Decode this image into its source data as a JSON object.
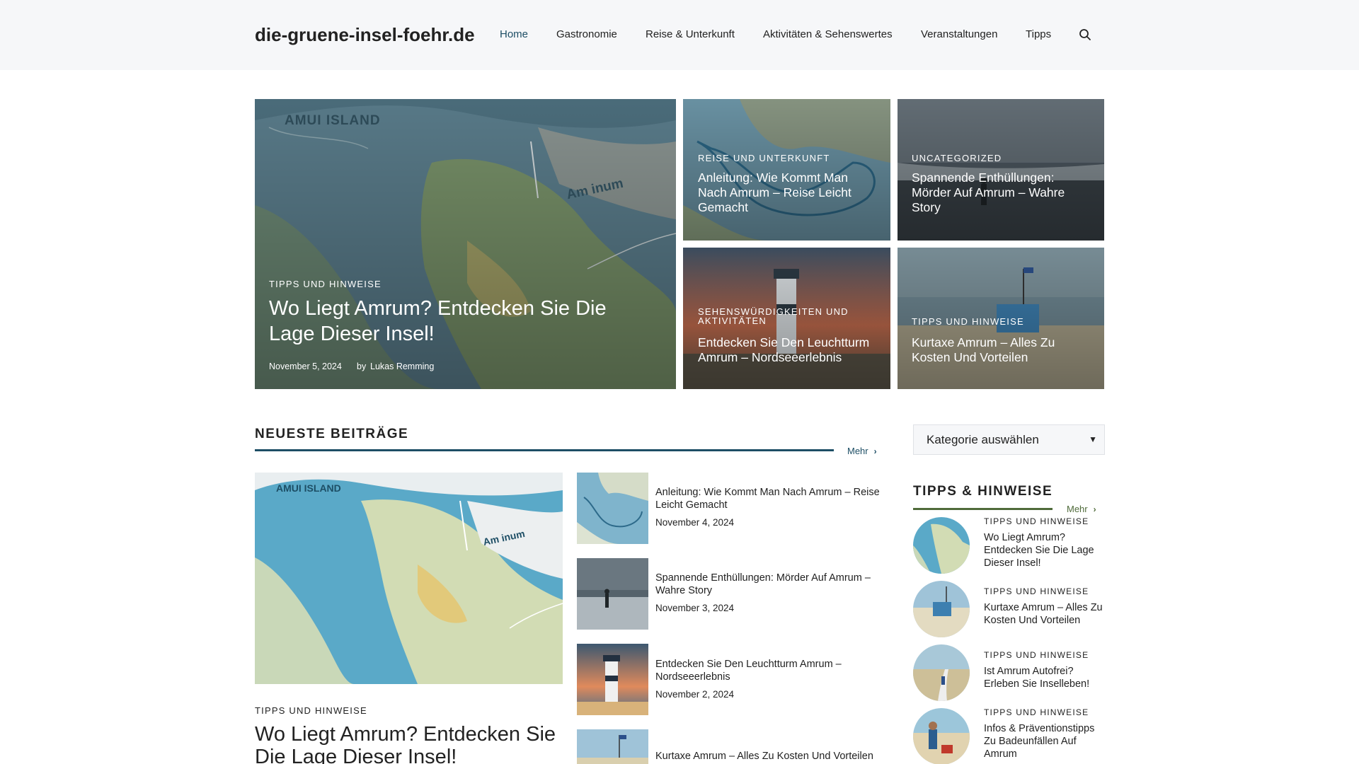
{
  "header": {
    "site_title": "die-gruene-insel-foehr.de",
    "nav": [
      "Home",
      "Gastronomie",
      "Reise & Unterkunft",
      "Aktivitäten & Sehenswertes",
      "Veranstaltungen",
      "Tipps"
    ],
    "active": "Home",
    "search_icon": "search-icon"
  },
  "hero": {
    "main": {
      "category": "TIPPS UND HINWEISE",
      "title": "Wo Liegt Amrum? Entdecken Sie Die Lage Dieser Insel!",
      "date": "November 5, 2024",
      "by": "by",
      "author": "Lukas Remming",
      "map_text_1": "AMUI ISLAND",
      "map_text_2": "Am inum"
    },
    "tiles": [
      {
        "category": "REISE UND UNTERKUNFT",
        "title": "Anleitung: Wie Kommt Man Nach Amrum – Reise Leicht Gemacht"
      },
      {
        "category": "UNCATEGORIZED",
        "title": "Spannende Enthüllungen: Mörder Auf Amrum – Wahre Story"
      },
      {
        "category": "SEHENSWÜRDIGKEITEN UND AKTIVITÄTEN",
        "title": "Entdecken Sie Den Leuchtturm Amrum – Nordseeerlebnis"
      },
      {
        "category": "TIPPS UND HINWEISE",
        "title": "Kurtaxe Amrum – Alles Zu Kosten Und Vorteilen"
      }
    ]
  },
  "latest": {
    "heading": "NEUESTE BEITRÄGE",
    "more": "Mehr",
    "featured": {
      "category": "TIPPS UND HINWEISE",
      "title": "Wo Liegt Amrum? Entdecken Sie Die Lage Dieser Insel!",
      "map_text_1": "AMUI ISLAND",
      "map_text_2": "Am inum"
    },
    "posts": [
      {
        "title": "Anleitung: Wie Kommt Man Nach Amrum – Reise Leicht Gemacht",
        "date": "November 4, 2024"
      },
      {
        "title": "Spannende Enthüllungen: Mörder Auf Amrum – Wahre Story",
        "date": "November 3, 2024"
      },
      {
        "title": "Entdecken Sie Den Leuchtturm Amrum – Nordseeerlebnis",
        "date": "November 2, 2024"
      },
      {
        "title": "Kurtaxe Amrum – Alles Zu Kosten Und Vorteilen",
        "date": ""
      }
    ]
  },
  "sidebar": {
    "select_label": "Kategorie auswählen",
    "heading": "TIPPS & HINWEISE",
    "more": "Mehr",
    "items": [
      {
        "category": "TIPPS UND HINWEISE",
        "title": "Wo Liegt Amrum? Entdecken Sie Die Lage Dieser Insel!"
      },
      {
        "category": "TIPPS UND HINWEISE",
        "title": "Kurtaxe Amrum – Alles Zu Kosten Und Vorteilen"
      },
      {
        "category": "TIPPS UND HINWEISE",
        "title": "Ist Amrum Autofrei? Erleben Sie Inselleben!"
      },
      {
        "category": "TIPPS UND HINWEISE",
        "title": "Infos & Präventionstipps Zu Badeunfällen Auf Amrum"
      }
    ]
  },
  "colors": {
    "accent": "#1d4e65",
    "header_bg": "#f6f7f9",
    "sidebar_rule": "#4f6b3a"
  }
}
